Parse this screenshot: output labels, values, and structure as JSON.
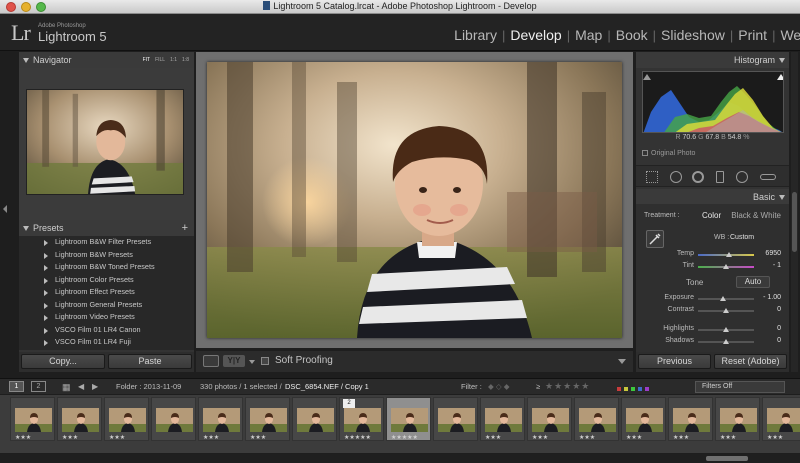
{
  "window": {
    "title": "Lightroom 5 Catalog.lrcat - Adobe Photoshop Lightroom - Develop"
  },
  "brand": {
    "logo": "Lr",
    "small": "Adobe Photoshop",
    "name": "Lightroom 5"
  },
  "modules": [
    {
      "label": "Library",
      "active": false
    },
    {
      "label": "Develop",
      "active": true
    },
    {
      "label": "Map",
      "active": false
    },
    {
      "label": "Book",
      "active": false
    },
    {
      "label": "Slideshow",
      "active": false
    },
    {
      "label": "Print",
      "active": false
    },
    {
      "label": "Web",
      "active": false
    }
  ],
  "navigator": {
    "title": "Navigator",
    "options": [
      "FIT",
      "FILL",
      "1:1",
      "1:8"
    ],
    "selected": "FIT"
  },
  "presets": {
    "title": "Presets",
    "items": [
      "Lightroom B&W Filter Presets",
      "Lightroom B&W Presets",
      "Lightroom B&W Toned Presets",
      "Lightroom Color Presets",
      "Lightroom Effect Presets",
      "Lightroom General Presets",
      "Lightroom Video Presets",
      "VSCO Film 01 LR4 Canon",
      "VSCO Film 01 LR4 Fuji"
    ]
  },
  "left_buttons": {
    "copy": "Copy...",
    "paste": "Paste"
  },
  "toolbar": {
    "yy": "Y|Y",
    "soft_proofing": "Soft Proofing"
  },
  "histogram": {
    "title": "Histogram",
    "r": "70.6",
    "g": "67.8",
    "b": "54.8",
    "r_label": "R",
    "g_label": "G",
    "b_label": "B",
    "percent": "%",
    "original_photo": "Original Photo"
  },
  "basic": {
    "title": "Basic",
    "treatment_label": "Treatment :",
    "color": "Color",
    "bw": "Black & White",
    "wb_label": "WB :",
    "wb_value": "Custom",
    "sliders": [
      {
        "label": "Temp",
        "value": "6950",
        "pos": 0.55
      },
      {
        "label": "Tint",
        "value": "- 1",
        "pos": 0.5
      },
      {
        "label": "Exposure",
        "value": "- 1.00",
        "pos": 0.45
      },
      {
        "label": "Contrast",
        "value": "0",
        "pos": 0.5
      },
      {
        "label": "Highlights",
        "value": "0",
        "pos": 0.5
      },
      {
        "label": "Shadows",
        "value": "0",
        "pos": 0.5
      }
    ],
    "tone": "Tone",
    "auto": "Auto"
  },
  "right_buttons": {
    "previous": "Previous",
    "reset": "Reset (Adobe)"
  },
  "filmstrip_bar": {
    "page1": "1",
    "page2": "2",
    "folder": "Folder : 2013-11-09",
    "count": "330 photos / 1 selected /",
    "file": "DSC_6854.NEF / Copy 1",
    "filter_label": "Filter :",
    "gte": "≥",
    "filters_off": "Filters Off"
  },
  "filmstrip": {
    "cells": [
      {
        "stars": "★★★",
        "selected": false
      },
      {
        "stars": "★★★",
        "selected": false
      },
      {
        "stars": "★★★",
        "selected": false
      },
      {
        "stars": "",
        "selected": false
      },
      {
        "stars": "★★★",
        "selected": false
      },
      {
        "stars": "★★★",
        "selected": false
      },
      {
        "stars": "",
        "selected": false
      },
      {
        "stars": "★★★★★",
        "selected": false,
        "count": "2"
      },
      {
        "stars": "★★★★★",
        "selected": true
      },
      {
        "stars": "",
        "selected": false
      },
      {
        "stars": "★★★",
        "selected": false
      },
      {
        "stars": "★★★",
        "selected": false
      },
      {
        "stars": "★★★",
        "selected": false
      },
      {
        "stars": "★★★",
        "selected": false
      },
      {
        "stars": "★★★",
        "selected": false
      },
      {
        "stars": "★★★",
        "selected": false
      },
      {
        "stars": "★★★",
        "selected": false
      }
    ]
  },
  "colors": {
    "accent_bg": "#1e1e1e",
    "panel": "#333333",
    "selected_thumb": "#8f8f8f"
  }
}
